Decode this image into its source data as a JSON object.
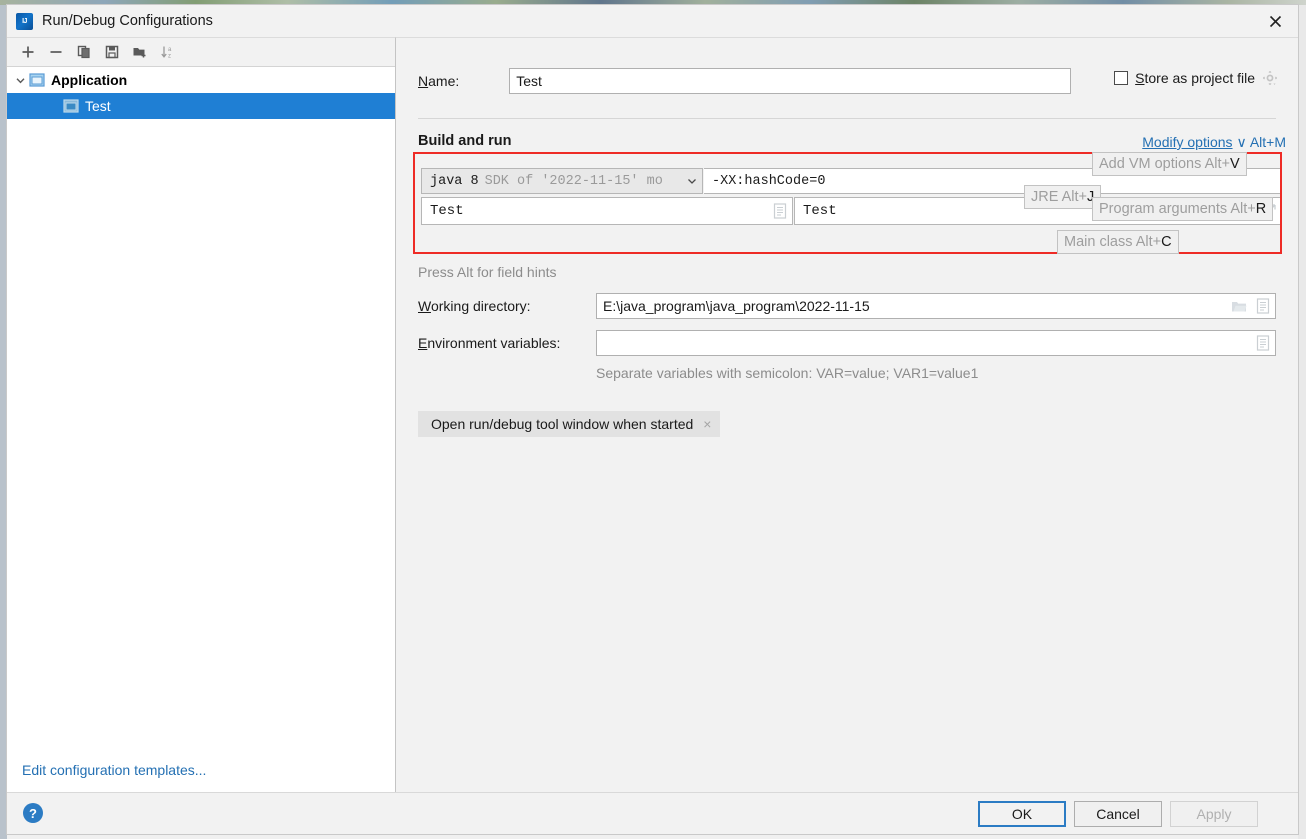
{
  "window": {
    "title": "Run/Debug Configurations",
    "logo_icon": "intellij-idea-logo",
    "close_icon": "close-icon"
  },
  "toolbar": {
    "items": [
      {
        "icon": "add-icon",
        "label": "Add New Configuration"
      },
      {
        "icon": "remove-icon",
        "label": "Remove Configuration"
      },
      {
        "icon": "copy-icon",
        "label": "Copy Configuration"
      },
      {
        "icon": "save-icon",
        "label": "Save Configuration"
      },
      {
        "icon": "new-folder-icon",
        "label": "Create New Folder"
      },
      {
        "icon": "sort-alphabetically-icon",
        "label": "Sort Configurations"
      }
    ]
  },
  "sidebar": {
    "tree": [
      {
        "label": "Application",
        "type": "group",
        "expanded": true,
        "icon": "application-window-icon"
      },
      {
        "label": "Test",
        "type": "configuration",
        "selected": true,
        "icon": "application-window-icon"
      }
    ],
    "edit_templates_link": "Edit configuration templates...",
    "selection_color": "#1f7fd4"
  },
  "form": {
    "name_label": "Name:",
    "name_mnemonic": "N",
    "name_value": "Test",
    "store_as_project_file": {
      "label": "Store as project file",
      "mnemonic": "S",
      "checked": false,
      "gear_icon": "gear-icon"
    },
    "build_and_run": {
      "section_label": "Build and run",
      "modify_options": {
        "text": "Modify options",
        "chevron": "∨",
        "shortcut": "Alt+M"
      },
      "jre": {
        "main_text": "java 8",
        "sub_text": "SDK of '2022-11-15' mo",
        "chevron_icon": "chevron-down-icon",
        "hint": "JRE Alt+",
        "hint_key": "J"
      },
      "vm_options": {
        "value": "-XX:hashCode=0",
        "hint": "Add VM options Alt+",
        "hint_key": "V",
        "expand_icon": "expand-icon",
        "list_icon": "list-icon"
      },
      "main_class": {
        "value": "Test",
        "hint": "Main class Alt+",
        "hint_key": "C",
        "list_icon": "list-icon"
      },
      "program_arguments": {
        "value": "Test",
        "hint": "Program arguments Alt+",
        "hint_key": "R",
        "expand_icon": "expand-icon",
        "list_icon": "list-icon"
      },
      "highlight_color": "#ee2b26"
    },
    "press_alt_hint": "Press Alt for field hints",
    "working_directory": {
      "label": "Working directory:",
      "mnemonic": "W",
      "value": "E:\\java_program\\java_program\\2022-11-15",
      "browse_icon": "folder-icon",
      "list_icon": "list-icon"
    },
    "environment_variables": {
      "label": "Environment variables:",
      "mnemonic": "E",
      "value": "",
      "list_icon": "list-icon"
    },
    "separate_note": "Separate variables with semicolon: VAR=value; VAR1=value1",
    "option_chip": {
      "label": "Open run/debug tool window when started",
      "remove_icon": "close-icon",
      "remove_glyph": "×"
    }
  },
  "footer": {
    "help_icon": "help-icon",
    "help_glyph": "?",
    "buttons": [
      {
        "label": "OK",
        "state": "default-focused"
      },
      {
        "label": "Cancel",
        "state": "normal"
      },
      {
        "label": "Apply",
        "state": "disabled"
      }
    ]
  }
}
